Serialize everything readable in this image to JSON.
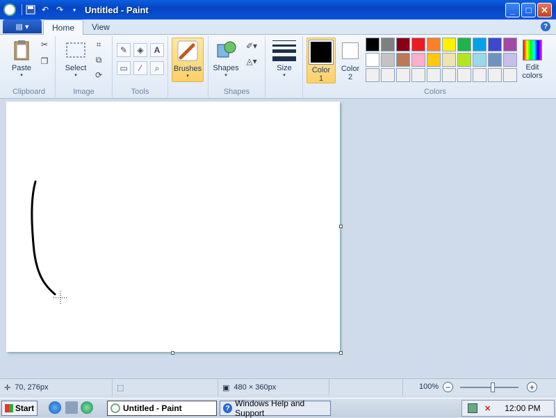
{
  "window": {
    "title": "Untitled - Paint"
  },
  "ribbon_tabs": {
    "home": "Home",
    "view": "View"
  },
  "groups": {
    "clipboard": {
      "label": "Clipboard",
      "paste": "Paste"
    },
    "image": {
      "label": "Image",
      "select": "Select"
    },
    "tools": {
      "label": "Tools"
    },
    "brushes": {
      "label": "Brushes"
    },
    "shapes": {
      "label": "Shapes",
      "shapes_btn": "Shapes"
    },
    "size": {
      "label": "Size"
    },
    "colors": {
      "label": "Colors",
      "color1": "Color 1",
      "color1_line1": "Color",
      "color1_line2": "1",
      "color2_line1": "Color",
      "color2_line2": "2",
      "edit_line1": "Edit",
      "edit_line2": "colors",
      "color1_value": "#000000",
      "color2_value": "#ffffff",
      "palette_row1": [
        "#000000",
        "#7f7f7f",
        "#880015",
        "#ed1c24",
        "#ff7f27",
        "#fff200",
        "#22b14c",
        "#00a2e8",
        "#3f48cc",
        "#a349a4"
      ],
      "palette_row2": [
        "#ffffff",
        "#c3c3c3",
        "#b97a57",
        "#ffaec9",
        "#ffc90e",
        "#efe4b0",
        "#b5e61d",
        "#99d9ea",
        "#7092be",
        "#c8bfe7"
      ],
      "palette_row3": [
        "#f0f0f0",
        "#f0f0f0",
        "#f0f0f0",
        "#f0f0f0",
        "#f0f0f0",
        "#f0f0f0",
        "#f0f0f0",
        "#f0f0f0",
        "#f0f0f0",
        "#f0f0f0"
      ]
    }
  },
  "status": {
    "cursor_pos": "70, 276px",
    "selection_size": "",
    "canvas_size": "480 × 360px",
    "zoom": "100%"
  },
  "taskbar": {
    "start": "Start",
    "tasks": [
      "Untitled - Paint",
      "Windows Help and Support"
    ],
    "clock": "12:00 PM"
  }
}
